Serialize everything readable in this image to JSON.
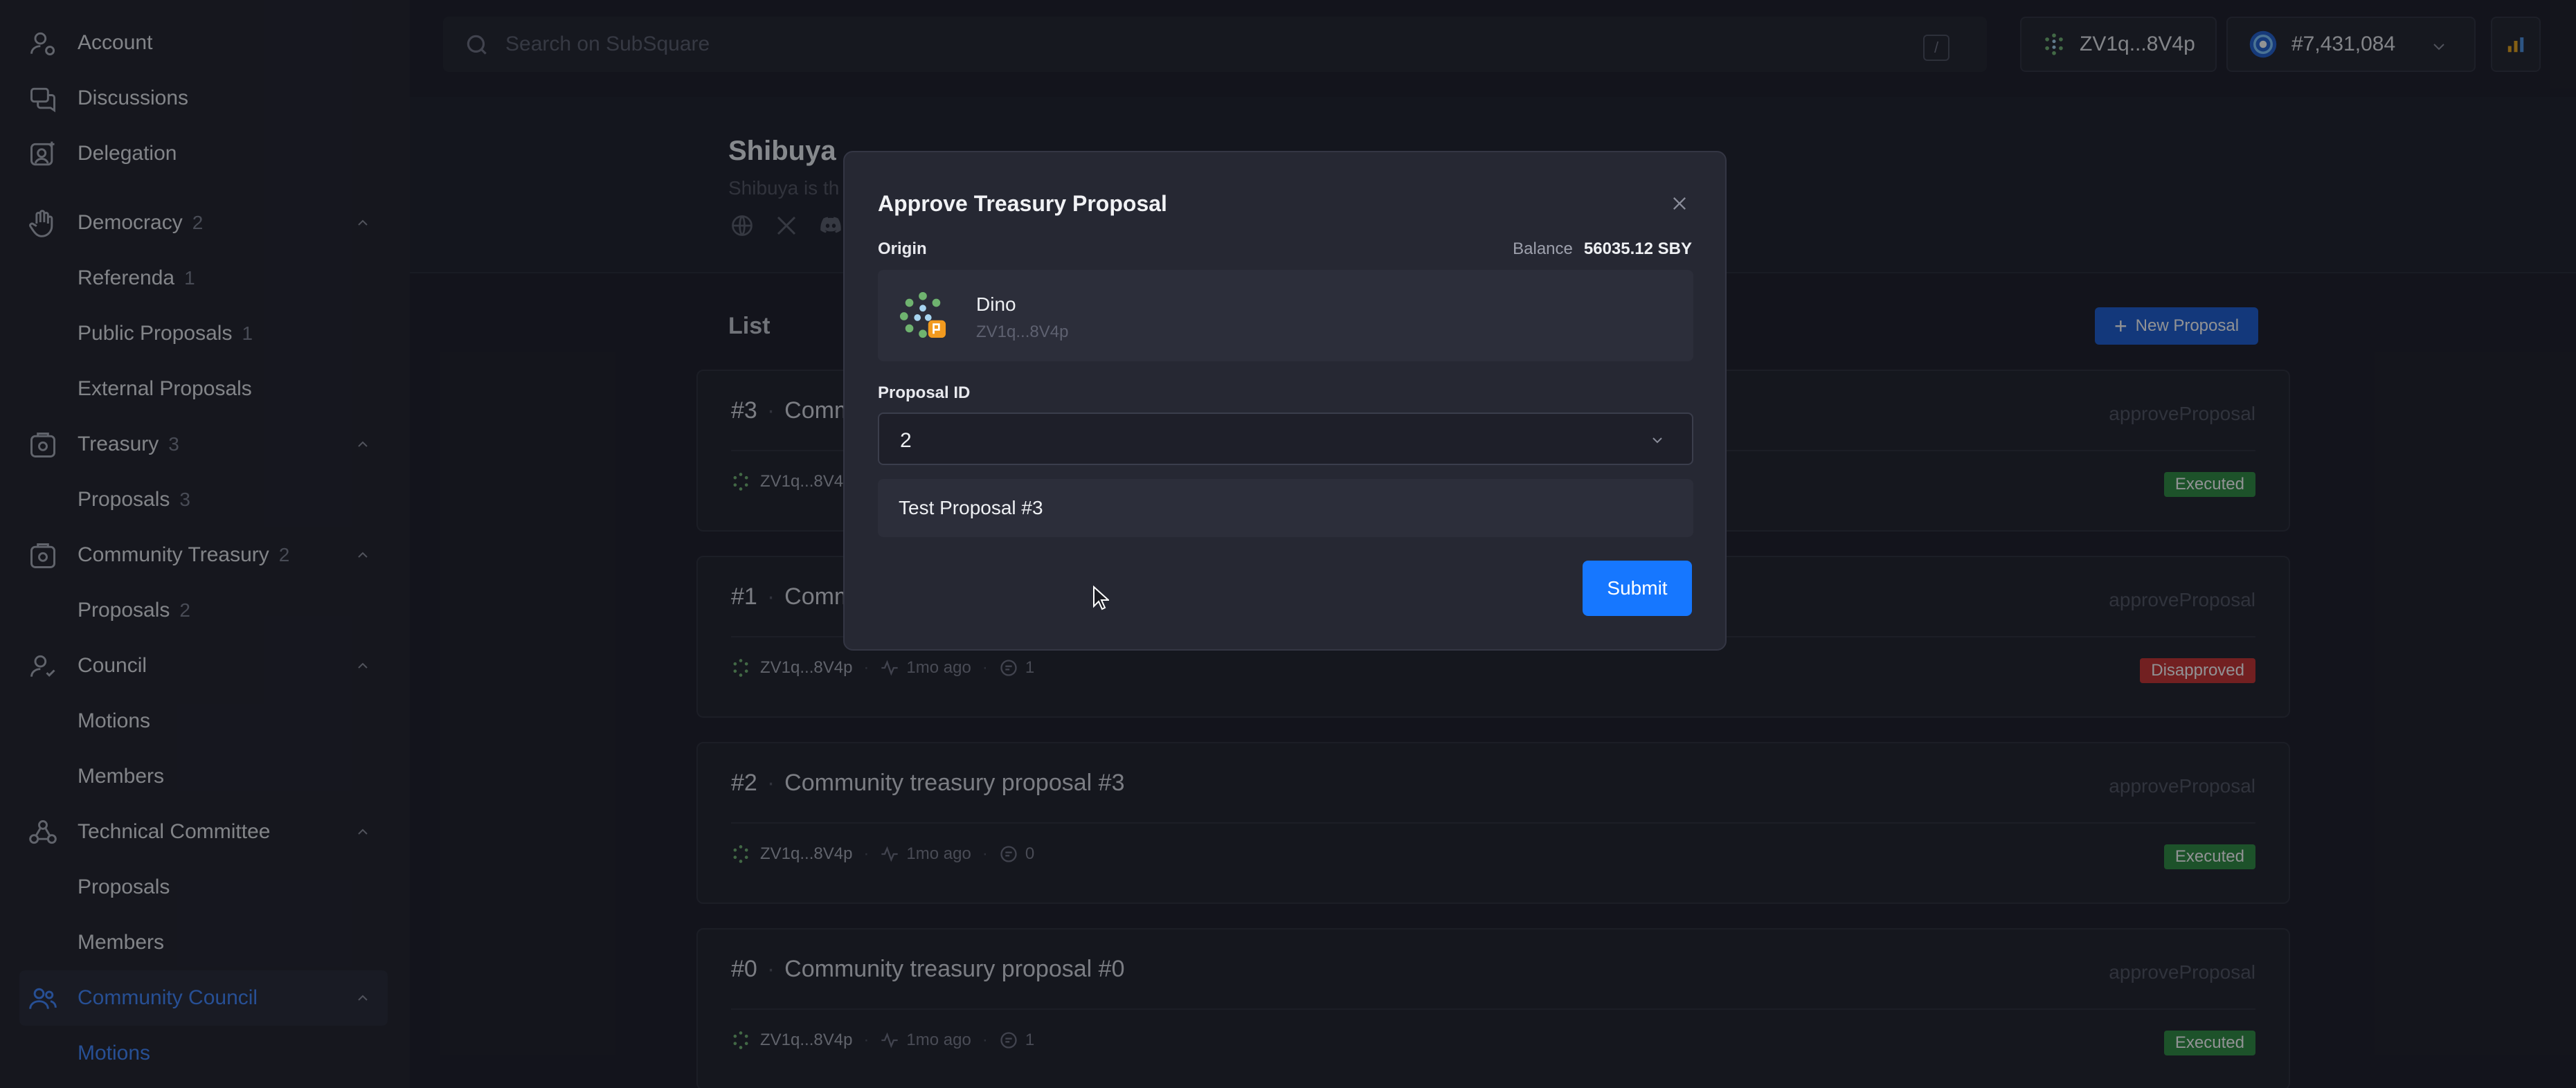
{
  "sidebar": {
    "items": [
      {
        "label": "Account",
        "icon": "account-icon"
      },
      {
        "label": "Discussions",
        "icon": "discussions-icon"
      },
      {
        "label": "Delegation",
        "icon": "delegation-icon"
      },
      {
        "label": "Democracy",
        "count": "2",
        "icon": "hand-icon",
        "expanded": true
      },
      {
        "label": "Referenda",
        "count": "1"
      },
      {
        "label": "Public Proposals",
        "count": "1"
      },
      {
        "label": "External Proposals"
      },
      {
        "label": "Treasury",
        "count": "3",
        "icon": "treasury-icon",
        "expanded": true
      },
      {
        "label": "Proposals",
        "count": "3"
      },
      {
        "label": "Community Treasury",
        "count": "2",
        "icon": "community-treasury-icon",
        "expanded": true
      },
      {
        "label": "Proposals",
        "count": "2"
      },
      {
        "label": "Council",
        "icon": "council-icon",
        "expanded": true
      },
      {
        "label": "Motions"
      },
      {
        "label": "Members"
      },
      {
        "label": "Technical Committee",
        "icon": "technical-committee-icon",
        "expanded": true
      },
      {
        "label": "Proposals"
      },
      {
        "label": "Members"
      },
      {
        "label": "Community Council",
        "icon": "community-council-icon",
        "expanded": true,
        "active": true
      },
      {
        "label": "Motions",
        "active": true
      }
    ]
  },
  "topbar": {
    "search_placeholder": "Search on SubSquare",
    "shortcut_key": "/",
    "account_address": "ZV1q...8V4p",
    "block_number": "#7,431,084"
  },
  "chain": {
    "name": "Shibuya",
    "description": "Shibuya is th"
  },
  "list": {
    "title": "List",
    "new_button": "New Proposal",
    "new_button_icon": "+",
    "cards": [
      {
        "id": "#3",
        "title": "Comm",
        "method": "approveProposal",
        "author": "ZV1q...8V4",
        "time": "",
        "comments": "",
        "status": "Executed",
        "status_type": "ok"
      },
      {
        "id": "#1",
        "title": "Comm",
        "method": "approveProposal",
        "author": "ZV1q...8V4p",
        "time": "1mo ago",
        "comments": "1",
        "status": "Disapproved",
        "status_type": "bad"
      },
      {
        "id": "#2",
        "title": "Community treasury proposal #3",
        "method": "approveProposal",
        "author": "ZV1q...8V4p",
        "time": "1mo ago",
        "comments": "0",
        "status": "Executed",
        "status_type": "ok"
      },
      {
        "id": "#0",
        "title": "Community treasury proposal #0",
        "method": "approveProposal",
        "author": "ZV1q...8V4p",
        "time": "1mo ago",
        "comments": "1",
        "status": "Executed",
        "status_type": "ok"
      }
    ]
  },
  "modal": {
    "title": "Approve Treasury Proposal",
    "origin_label": "Origin",
    "balance_label": "Balance",
    "balance_value": "56035.12 SBY",
    "origin_name": "Dino",
    "origin_address": "ZV1q...8V4p",
    "proposal_id_label": "Proposal ID",
    "proposal_id_value": "2",
    "proposal_title": "Test Proposal #3",
    "submit_label": "Submit"
  },
  "colors": {
    "accent": "#1677ff",
    "executed": "#2d8a3e",
    "disapproved": "#c7312f",
    "active_nav": "#3f86ff"
  }
}
